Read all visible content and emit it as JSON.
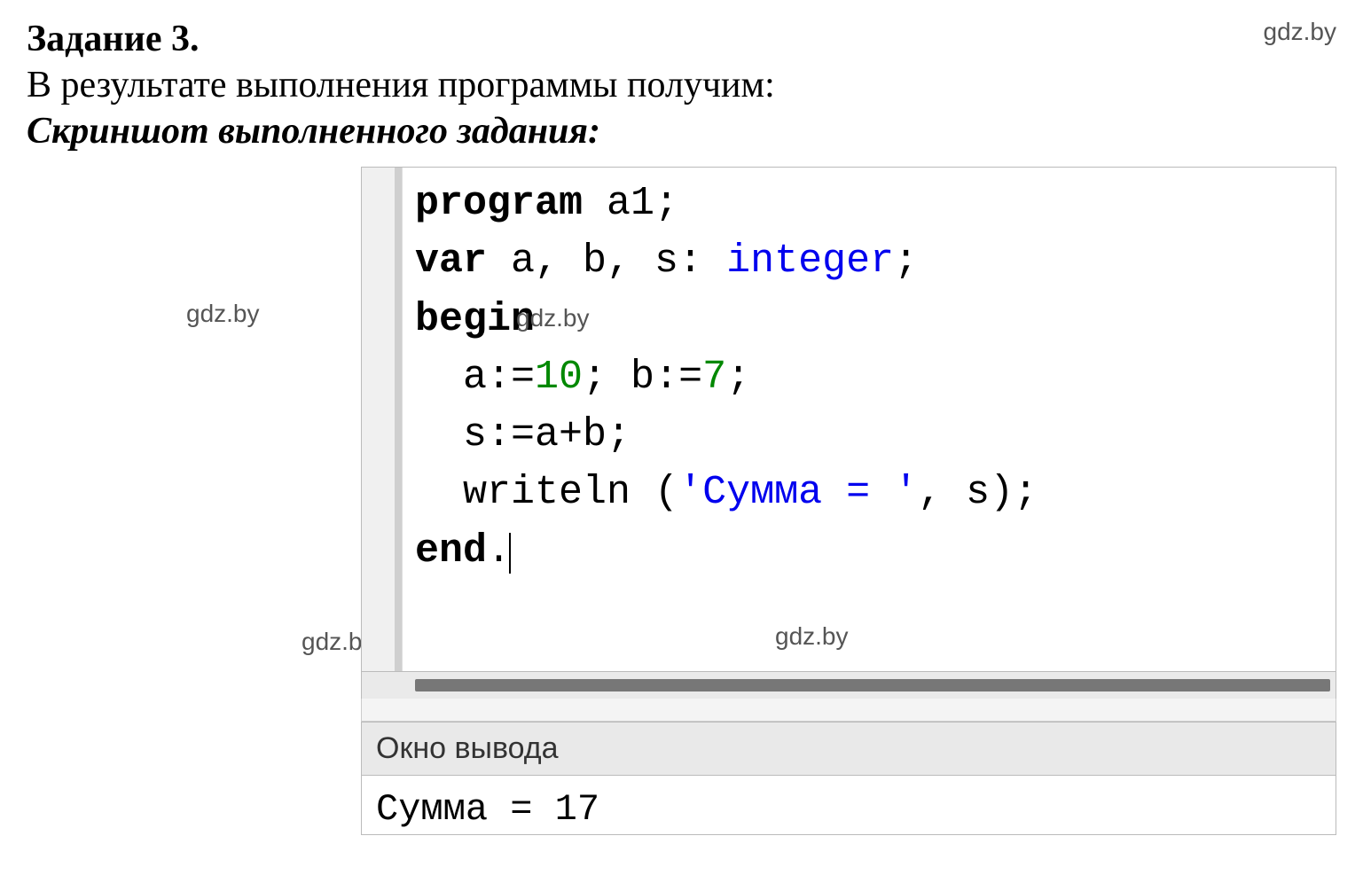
{
  "task": {
    "title": "Задание 3.",
    "intro": "В результате выполнения программы получим:",
    "screenshot_label": "Скриншот выполненного задания:"
  },
  "watermark": "gdz.by",
  "code": {
    "l1": {
      "kw": "program",
      "rest": " a1;"
    },
    "l2": {
      "kw": "var",
      "rest": " a, b, s: ",
      "typ": "integer",
      "tail": ";"
    },
    "l3": {
      "kw": "begin"
    },
    "l4": {
      "indent": "  a:=",
      "n1": "10",
      "mid": "; b:=",
      "n2": "7",
      "tail": ";"
    },
    "l5": "  s:=a+b;",
    "l6": {
      "pre": "  writeln (",
      "str": "'Сумма = '",
      "post": ", s);"
    },
    "l7": {
      "kw": "end",
      "tail": "."
    }
  },
  "output": {
    "title": "Окно вывода",
    "line": "Сумма = 17"
  }
}
